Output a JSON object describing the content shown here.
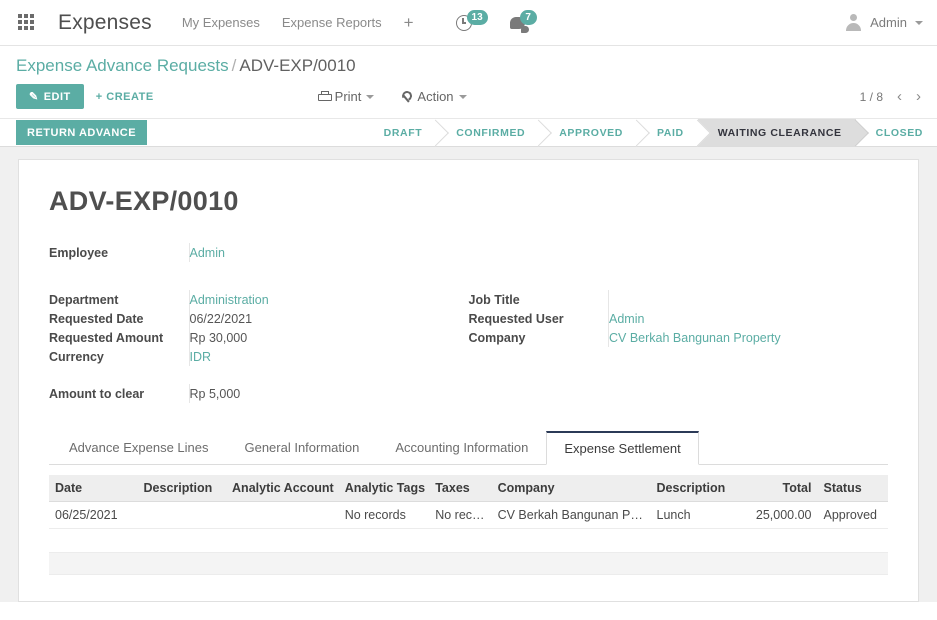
{
  "navbar": {
    "apps_icon": "apps-grid-icon",
    "brand": "Expenses",
    "menu": [
      {
        "label": "My Expenses"
      },
      {
        "label": "Expense Reports"
      }
    ],
    "plus": "+",
    "systray": [
      {
        "icon": "clock-icon",
        "count": "13"
      },
      {
        "icon": "chat-icon",
        "count": "7"
      }
    ],
    "user": "Admin"
  },
  "control_panel": {
    "breadcrumb_root": "Expense Advance Requests",
    "breadcrumb_sep": "/",
    "breadcrumb_current": "ADV-EXP/0010",
    "edit_label": "EDIT",
    "create_label": "+ CREATE",
    "print_label": "Print",
    "action_label": "Action",
    "pager": "1 / 8",
    "prev_arrow": "‹",
    "next_arrow": "›"
  },
  "status": {
    "return_advance_label": "RETURN ADVANCE",
    "steps": [
      {
        "label": "DRAFT",
        "active": false
      },
      {
        "label": "CONFIRMED",
        "active": false
      },
      {
        "label": "APPROVED",
        "active": false
      },
      {
        "label": "PAID",
        "active": false
      },
      {
        "label": "WAITING CLEARANCE",
        "active": true
      },
      {
        "label": "CLOSED",
        "active": false
      }
    ]
  },
  "form": {
    "title": "ADV-EXP/0010",
    "employee_label": "Employee",
    "employee_value": "Admin",
    "left_fields": [
      {
        "label": "Department",
        "value": "Administration",
        "link": true
      },
      {
        "label": "Requested Date",
        "value": "06/22/2021",
        "link": false
      },
      {
        "label": "Requested Amount",
        "value": "Rp 30,000",
        "link": false
      },
      {
        "label": "Currency",
        "value": "IDR",
        "link": true
      }
    ],
    "right_fields": [
      {
        "label": "Job Title",
        "value": "",
        "link": false
      },
      {
        "label": "Requested User",
        "value": "Admin",
        "link": true
      },
      {
        "label": "Company",
        "value": "CV Berkah Bangunan Property",
        "link": true
      }
    ],
    "amount_to_clear_label": "Amount to clear",
    "amount_to_clear_value": "Rp 5,000"
  },
  "notebook": {
    "tabs": [
      {
        "label": "Advance Expense Lines",
        "active": false
      },
      {
        "label": "General Information",
        "active": false
      },
      {
        "label": "Accounting Information",
        "active": false
      },
      {
        "label": "Expense Settlement",
        "active": true
      }
    ]
  },
  "list": {
    "columns": [
      {
        "label": "Date",
        "align": "left"
      },
      {
        "label": "Description",
        "align": "left"
      },
      {
        "label": "Analytic Account",
        "align": "left"
      },
      {
        "label": "Analytic Tags",
        "align": "left"
      },
      {
        "label": "Taxes",
        "align": "left"
      },
      {
        "label": "Company",
        "align": "left"
      },
      {
        "label": "Description",
        "align": "left"
      },
      {
        "label": "Total",
        "align": "right"
      },
      {
        "label": "Status",
        "align": "left"
      }
    ],
    "rows": [
      {
        "date": "06/25/2021",
        "description": "",
        "analytic_account": "",
        "analytic_tags": "No records",
        "taxes": "No records",
        "company": "CV Berkah Bangunan Pro...",
        "description2": "Lunch",
        "total": "25,000.00",
        "status": "Approved"
      }
    ]
  },
  "colors": {
    "accent": "#5bada4",
    "active_tab_border": "#2b3a57",
    "statusbar_active_bg": "#dddddd"
  }
}
